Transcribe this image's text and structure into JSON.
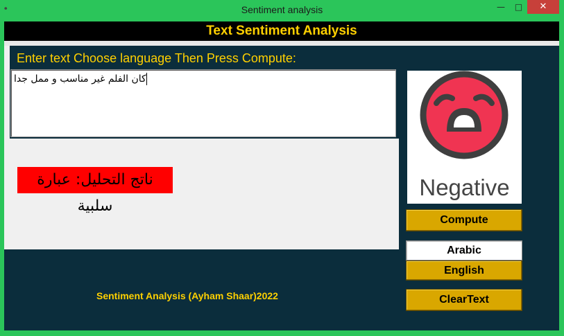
{
  "window": {
    "title": "Sentiment analysis",
    "icon": "app-icon",
    "min_glyph": "—",
    "max_glyph": "□",
    "close_glyph": "✕"
  },
  "header": {
    "title": "Text Sentiment Analysis"
  },
  "instruction": "Enter text Choose language  Then Press Compute:",
  "input": {
    "value": "كان الفلم غير مناسب و ممل جدا"
  },
  "result": {
    "text": "ناتج التحليل: عبارة سلبية",
    "color": "#ff0000"
  },
  "sentiment": {
    "label": "Negative",
    "icon": "sad-face-icon",
    "face_color": "#f03452"
  },
  "buttons": {
    "compute": "Compute",
    "arabic": "Arabic",
    "english": "English",
    "clear": "ClearText"
  },
  "footer": "Sentiment Analysis (Ayham Shaar)2022",
  "colors": {
    "accent": "#ffd000",
    "background": "#0b2d3c",
    "button": "#d9a700",
    "titlebar": "#2bc55a"
  }
}
